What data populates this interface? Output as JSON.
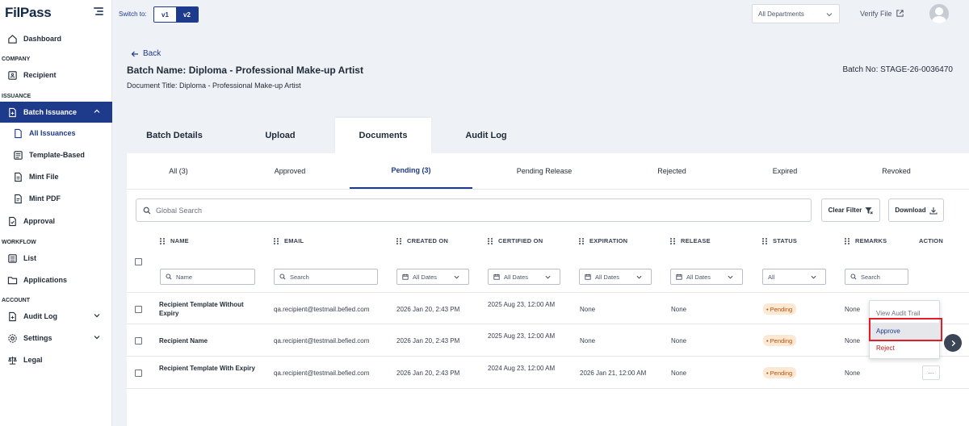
{
  "app": {
    "logo": "FilPass"
  },
  "sidebar": {
    "dashboard": "Dashboard",
    "section_company": "COMPANY",
    "recipient": "Recipient",
    "section_issuance": "ISSUANCE",
    "batch_issuance": "Batch Issuance",
    "all_issuances": "All Issuances",
    "template_based": "Template-Based",
    "mint_file": "Mint File",
    "mint_pdf": "Mint PDF",
    "approval": "Approval",
    "section_workflow": "WORKFLOW",
    "list": "List",
    "applications": "Applications",
    "section_account": "ACCOUNT",
    "audit_log": "Audit Log",
    "settings": "Settings",
    "legal": "Legal"
  },
  "topbar": {
    "switch_label": "Switch to:",
    "v1": "v1",
    "v2": "v2",
    "department": "All Departments",
    "verify": "Verify File"
  },
  "header": {
    "back": "Back",
    "batch_name": "Batch Name: Diploma - Professional Make-up Artist",
    "document_title": "Document Title: Diploma - Professional Make-up Artist",
    "batch_no": "Batch No: STAGE-26-0036470"
  },
  "main_tabs": [
    "Batch Details",
    "Upload",
    "Documents",
    "Audit Log"
  ],
  "sub_tabs": [
    "All (3)",
    "Approved",
    "Pending (3)",
    "Pending Release",
    "Rejected",
    "Expired",
    "Revoked"
  ],
  "toolbar": {
    "search_placeholder": "Global Search",
    "clear_filter": "Clear Filter",
    "download": "Download"
  },
  "columns": [
    "NAME",
    "EMAIL",
    "CREATED ON",
    "CERTIFIED ON",
    "EXPIRATION",
    "RELEASE",
    "STATUS",
    "REMARKS",
    "ACTION"
  ],
  "filters": {
    "name": "Name",
    "email": "Search",
    "created": "All Dates",
    "certified": "All Dates",
    "expiration": "All Dates",
    "release": "All Dates",
    "status": "All",
    "remarks": "Search"
  },
  "rows": [
    {
      "name": "Recipient Template Without Expiry",
      "email": "qa.recipient@testmail.befied.com",
      "created": "2026 Jan 20, 2:43 PM",
      "certified": "2025 Aug 23, 12:00 AM",
      "expiration": "None",
      "release": "None",
      "status": "Pending",
      "remarks": "None"
    },
    {
      "name": "Recipient Name",
      "email": "qa.recipient@testmail.befied.com",
      "created": "2026 Jan 20, 2:43 PM",
      "certified": "2025 Aug 23, 12:00 AM",
      "expiration": "None",
      "release": "None",
      "status": "Pending",
      "remarks": "None"
    },
    {
      "name": "Recipient Template With Expiry",
      "email": "qa.recipient@testmail.befied.com",
      "created": "2026 Jan 20, 2:43 PM",
      "certified": "2024 Aug 23, 12:00 AM",
      "expiration": "2026 Jan 21, 12:00 AM",
      "release": "None",
      "status": "Pending",
      "remarks": "None"
    }
  ],
  "action_menu": {
    "view": "View Audit Trail",
    "approve": "Approve",
    "reject": "Reject",
    "more": "···"
  },
  "colors": {
    "primary": "#1e3a8a",
    "highlight": "#e11d2a",
    "pending_bg": "#fde8d4",
    "pending_text": "#b45309"
  }
}
